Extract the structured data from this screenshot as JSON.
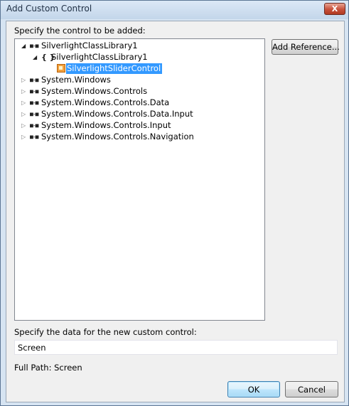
{
  "window": {
    "title": "Add Custom Control",
    "close_glyph": "X"
  },
  "specify_control_label": "Specify the control to be added:",
  "tree": {
    "items": [
      {
        "label": "SilverlightClassLibrary1",
        "expander": "◢",
        "icon": "namespace-icon",
        "level": 0
      },
      {
        "label": "SilverlightClassLibrary1",
        "expander": "◢",
        "icon": "braces-icon",
        "level": 1
      },
      {
        "label": "SilverlightSliderControl",
        "expander": "",
        "icon": "class-icon",
        "level": 2,
        "selected": true
      },
      {
        "label": "System.Windows",
        "expander": "▷",
        "icon": "namespace-icon",
        "level": 0
      },
      {
        "label": "System.Windows.Controls",
        "expander": "▷",
        "icon": "namespace-icon",
        "level": 0
      },
      {
        "label": "System.Windows.Controls.Data",
        "expander": "▷",
        "icon": "namespace-icon",
        "level": 0
      },
      {
        "label": "System.Windows.Controls.Data.Input",
        "expander": "▷",
        "icon": "namespace-icon",
        "level": 0
      },
      {
        "label": "System.Windows.Controls.Input",
        "expander": "▷",
        "icon": "namespace-icon",
        "level": 0
      },
      {
        "label": "System.Windows.Controls.Navigation",
        "expander": "▷",
        "icon": "namespace-icon",
        "level": 0
      }
    ],
    "namespace_glyph": "■-■",
    "braces_glyph": "{ }"
  },
  "add_reference_label": "Add Reference...",
  "specify_data_label": "Specify the data for the new custom control:",
  "data_value": "Screen",
  "full_path": "Full Path: Screen",
  "ok_label": "OK",
  "cancel_label": "Cancel",
  "colors": {
    "selection": "#3399ff",
    "default_button_border": "#3c7fb1",
    "close_button": "#c7503a"
  }
}
